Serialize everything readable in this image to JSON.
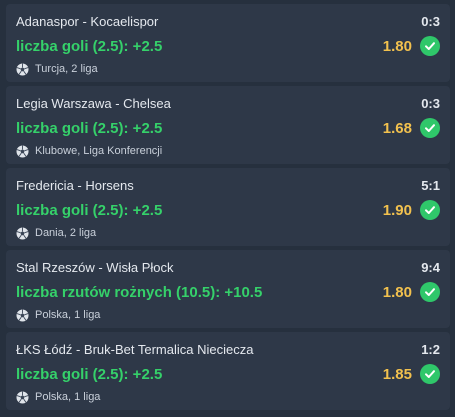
{
  "bets": [
    {
      "match": "Adanaspor - Kocaelispor",
      "score": "0:3",
      "bet": "liczba goli (2.5): +2.5",
      "odds": "1.80",
      "league": "Turcja, 2 liga",
      "status_icon": "check-circle-icon"
    },
    {
      "match": "Legia Warszawa - Chelsea",
      "score": "0:3",
      "bet": "liczba goli (2.5): +2.5",
      "odds": "1.68",
      "league": "Klubowe, Liga Konferencji",
      "status_icon": "check-circle-icon"
    },
    {
      "match": "Fredericia - Horsens",
      "score": "5:1",
      "bet": "liczba goli (2.5): +2.5",
      "odds": "1.90",
      "league": "Dania, 2 liga",
      "status_icon": "check-circle-icon"
    },
    {
      "match": "Stal Rzeszów - Wisła Płock",
      "score": "9:4",
      "bet": "liczba rzutów rożnych (10.5): +10.5",
      "odds": "1.80",
      "league": "Polska, 1 liga",
      "status_icon": "check-circle-icon"
    },
    {
      "match": "ŁKS Łódź - Bruk-Bet Termalica Nieciecza",
      "score": "1:2",
      "bet": "liczba goli (2.5): +2.5",
      "odds": "1.85",
      "league": "Polska, 1 liga",
      "status_icon": "check-circle-icon"
    }
  ],
  "colors": {
    "background": "#26303e",
    "card": "#2e3848",
    "bet_text": "#35d16a",
    "odds": "#f2c14e",
    "check": "#2fc76a"
  },
  "icons": {
    "sport": "soccer-ball-icon",
    "status": "check-circle-icon"
  }
}
